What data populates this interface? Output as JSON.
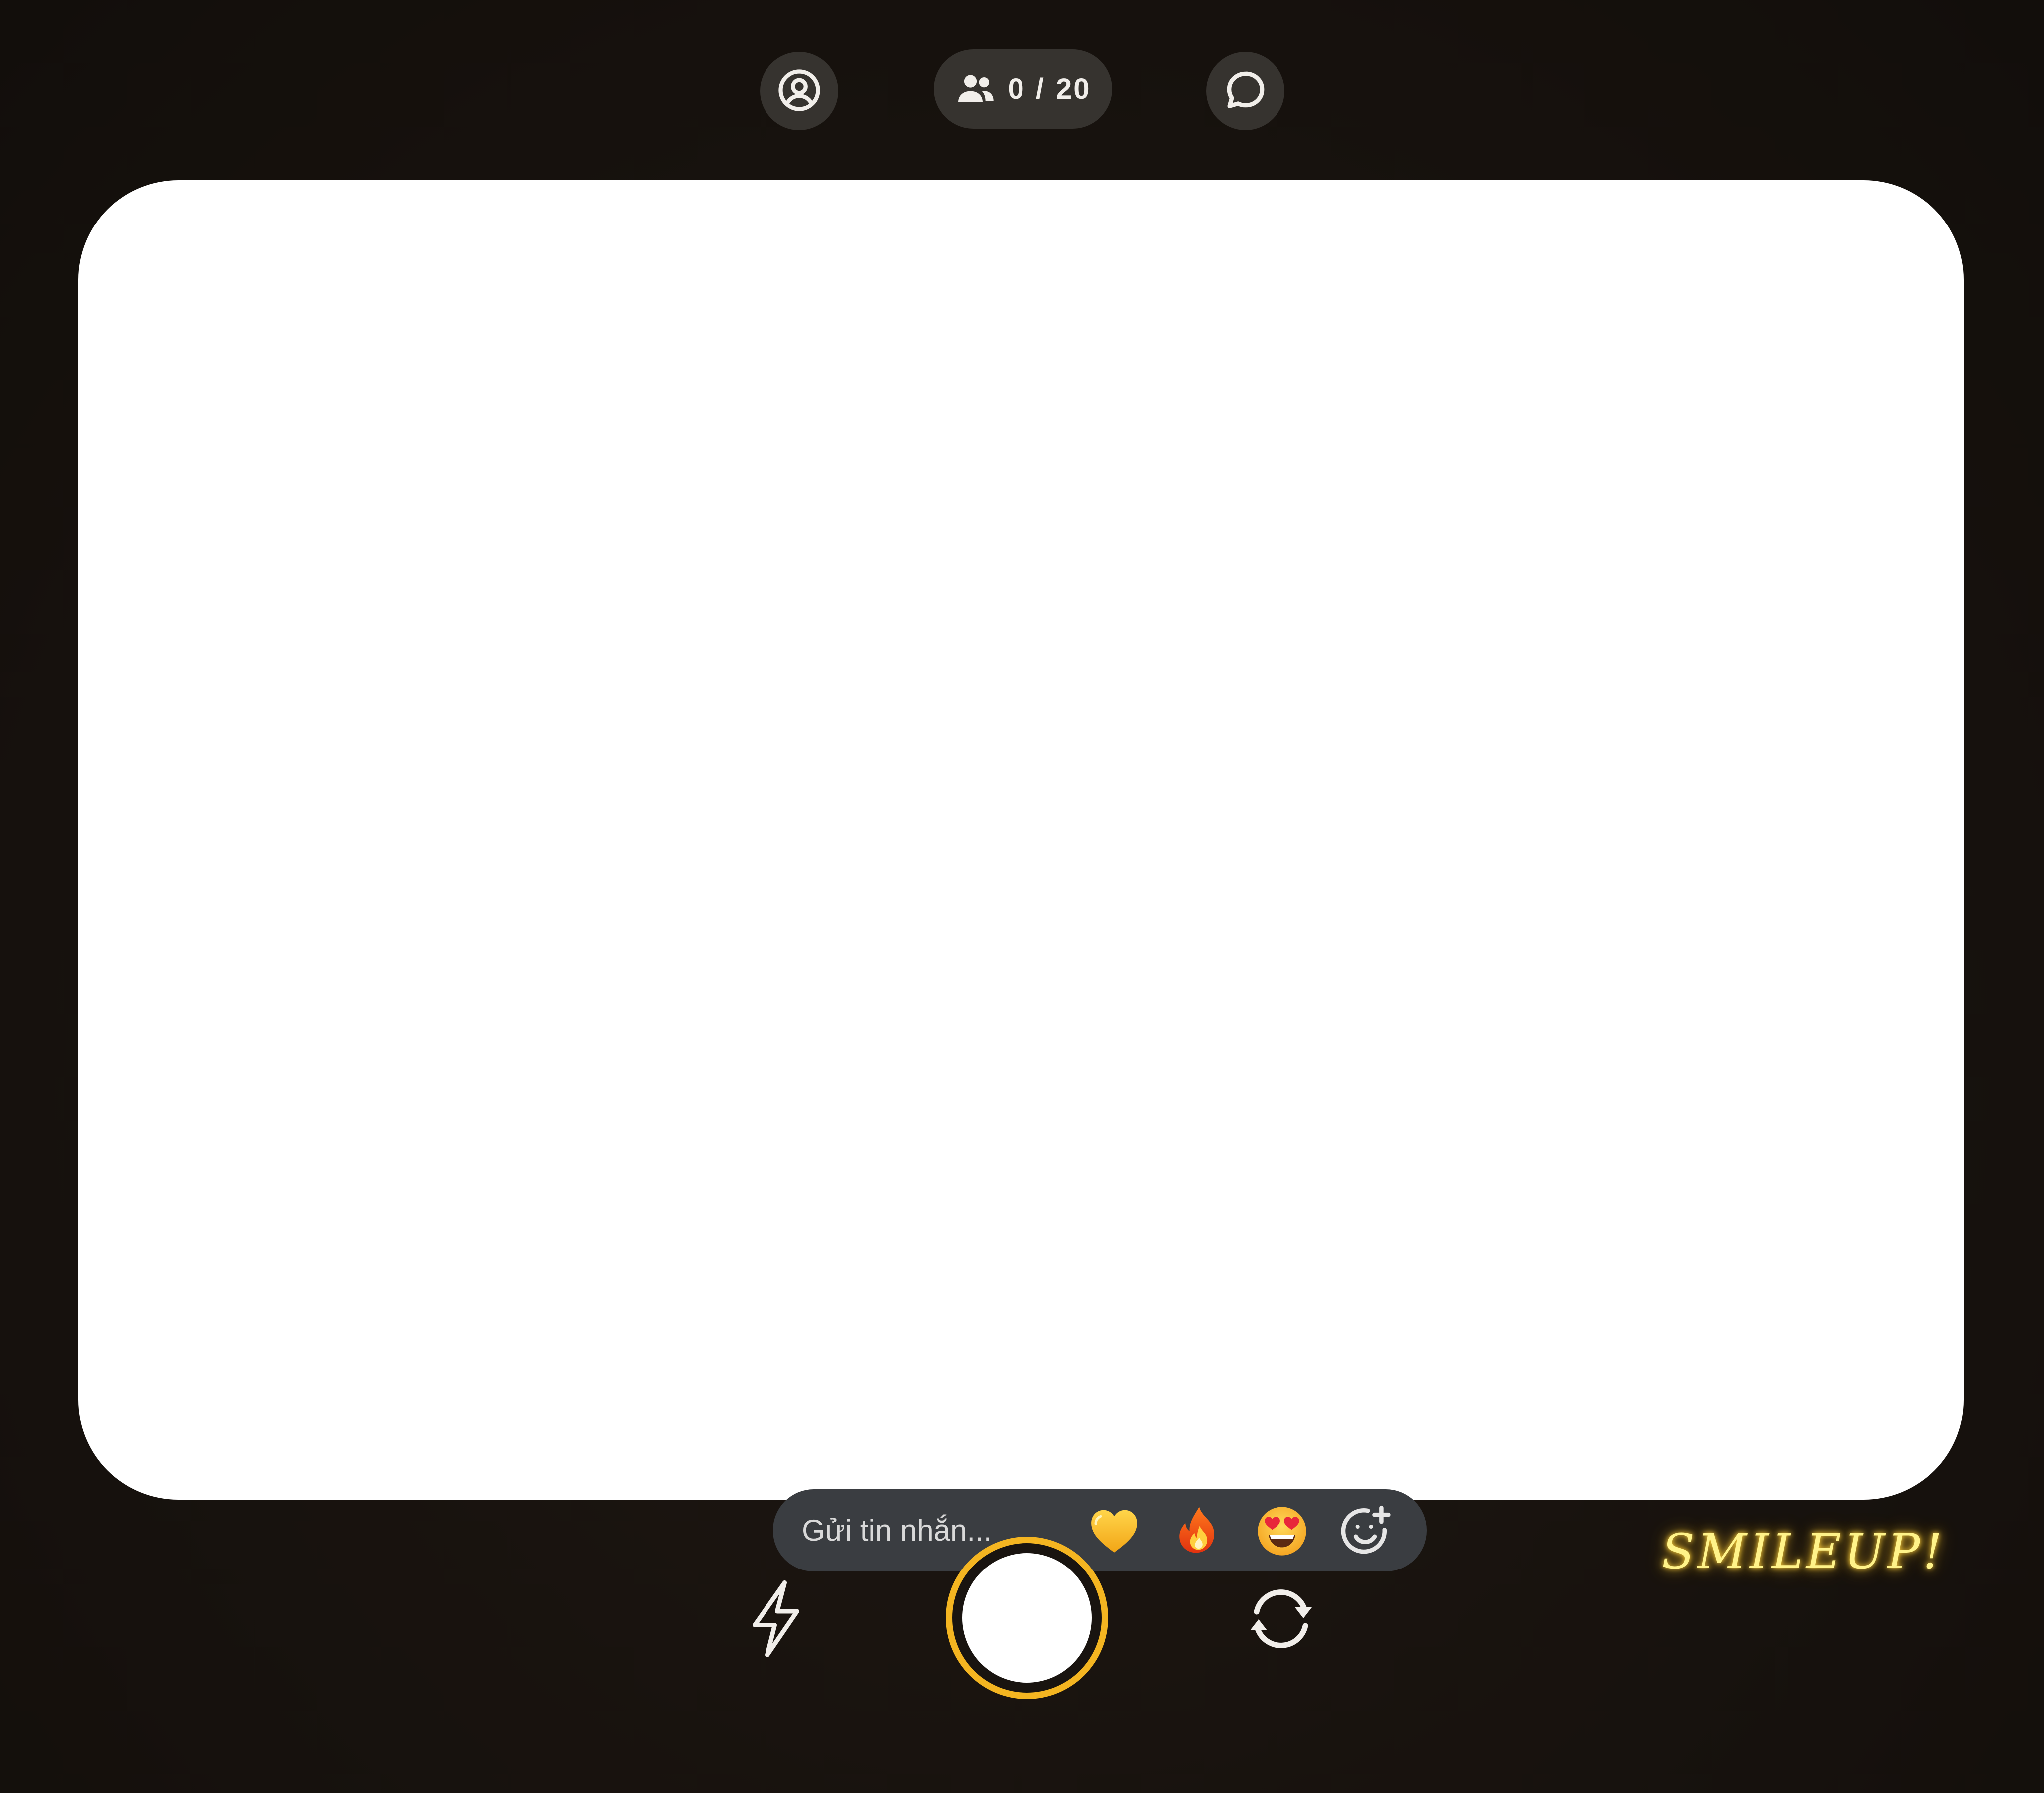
{
  "top_bar": {
    "profile_icon": "user-circle-icon",
    "friends": {
      "icon": "people-icon",
      "count_text": "0 / 20"
    },
    "chat_icon": "chat-bubble-icon"
  },
  "composer": {
    "placeholder": "Gửi tin nhắn...",
    "reactions": [
      "yellow-heart",
      "fire",
      "smiling-face-with-heart-eyes"
    ],
    "add_reaction_icon": "add-emoji-icon"
  },
  "controls": {
    "flash_icon": "lightning-icon",
    "shutter": "shutter-button",
    "flip_icon": "camera-flip-icon"
  },
  "brand": {
    "logo_text": "SMILEUP!"
  },
  "colors": {
    "background": "#191410",
    "control_bg": "#36332f",
    "composer_bg": "#3a3d41",
    "accent": "#f4b521",
    "viewfinder": "#ffffff",
    "logo_glow": "#fff389"
  }
}
